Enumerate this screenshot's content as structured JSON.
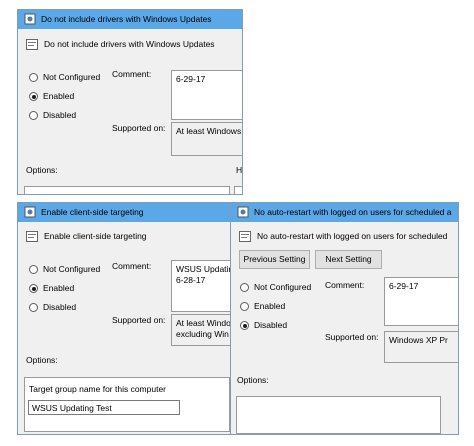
{
  "win1": {
    "title": "Do not include drivers with Windows Updates",
    "policy_name": "Do not include drivers with Windows Updates",
    "radio_not_configured": "Not Configured",
    "radio_enabled": "Enabled",
    "radio_disabled": "Disabled",
    "selected": "Enabled",
    "comment_label": "Comment:",
    "comment": "6-29-17",
    "supported_label": "Supported on:",
    "supported": "At least Windows",
    "options_label": "Options:",
    "help_label_partial": "H"
  },
  "win2": {
    "title": "Enable client-side targeting",
    "policy_name": "Enable client-side targeting",
    "radio_not_configured": "Not Configured",
    "radio_enabled": "Enabled",
    "radio_disabled": "Disabled",
    "selected": "Enabled",
    "comment_label": "Comment:",
    "comment": "WSUS Updatin\n6-28-17",
    "supported_label": "Supported on:",
    "supported": "At least Windo\nexcluding Win",
    "options_label": "Options:",
    "target_group_label": "Target group name for this computer",
    "target_group_value": "WSUS Updating Test"
  },
  "win3": {
    "title": "No auto-restart with logged on users for scheduled a",
    "policy_name": "No auto-restart with logged on users for scheduled",
    "prev_button": "Previous Setting",
    "next_button": "Next Setting",
    "radio_not_configured": "Not Configured",
    "radio_enabled": "Enabled",
    "radio_disabled": "Disabled",
    "selected": "Disabled",
    "comment_label": "Comment:",
    "comment": "6-29-17",
    "supported_label": "Supported on:",
    "supported": "Windows XP Pr",
    "options_label": "Options:"
  },
  "colors": {
    "titlebar": "#5aa8e8",
    "window_bg": "#f0f0f0"
  },
  "icons": {
    "title_icon": "policy-settings-icon",
    "policy_icon": "policy-document-icon"
  }
}
